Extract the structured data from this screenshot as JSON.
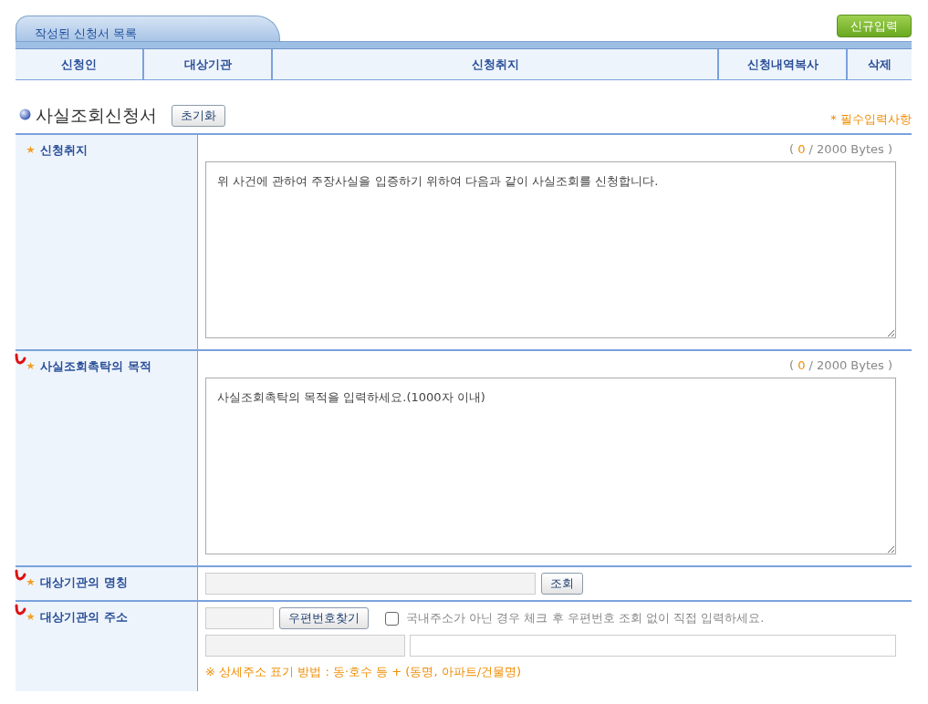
{
  "list_panel": {
    "tab_title": "작성된 신청서 목록",
    "new_button": "신규입력",
    "columns": [
      {
        "label": "신청인"
      },
      {
        "label": "대상기관"
      },
      {
        "label": "신청취지"
      },
      {
        "label": "신청내역복사"
      },
      {
        "label": "삭제"
      }
    ]
  },
  "form": {
    "title": "사실조회신청서",
    "reset_button": "초기화",
    "required_note": "* 필수입력사항",
    "rows": [
      {
        "kind": "textarea",
        "label": "신청취지",
        "counter": {
          "open": "(",
          "count": "0",
          "close": "/ 2000 Bytes )"
        },
        "value": "위 사건에 관하여 주장사실을 입증하기 위하여 다음과 같이 사실조회를 신청합니다.",
        "annotated": false
      },
      {
        "kind": "textarea",
        "label": "사실조회촉탁의 목적",
        "counter": {
          "open": "(",
          "count": "0",
          "close": "/ 2000 Bytes )"
        },
        "placeholder": "사실조회촉탁의 목적을 입력하세요.(1000자 이내)",
        "annotated": true
      },
      {
        "kind": "search",
        "label": "대상기관의 명칭",
        "button": "조회",
        "annotated": true
      },
      {
        "kind": "address",
        "label": "대상기관의 주소",
        "button": "우편번호찾기",
        "checkbox": {
          "label": "국내주소가 아닌 경우 체크 후 우편번호 조회 없이 직접 입력하세요.",
          "checked": false
        },
        "hint": "※ 상세주소 표기 방법 : 동·호수 등 + (동명, 아파트/건물명)",
        "annotated": true
      }
    ]
  }
}
